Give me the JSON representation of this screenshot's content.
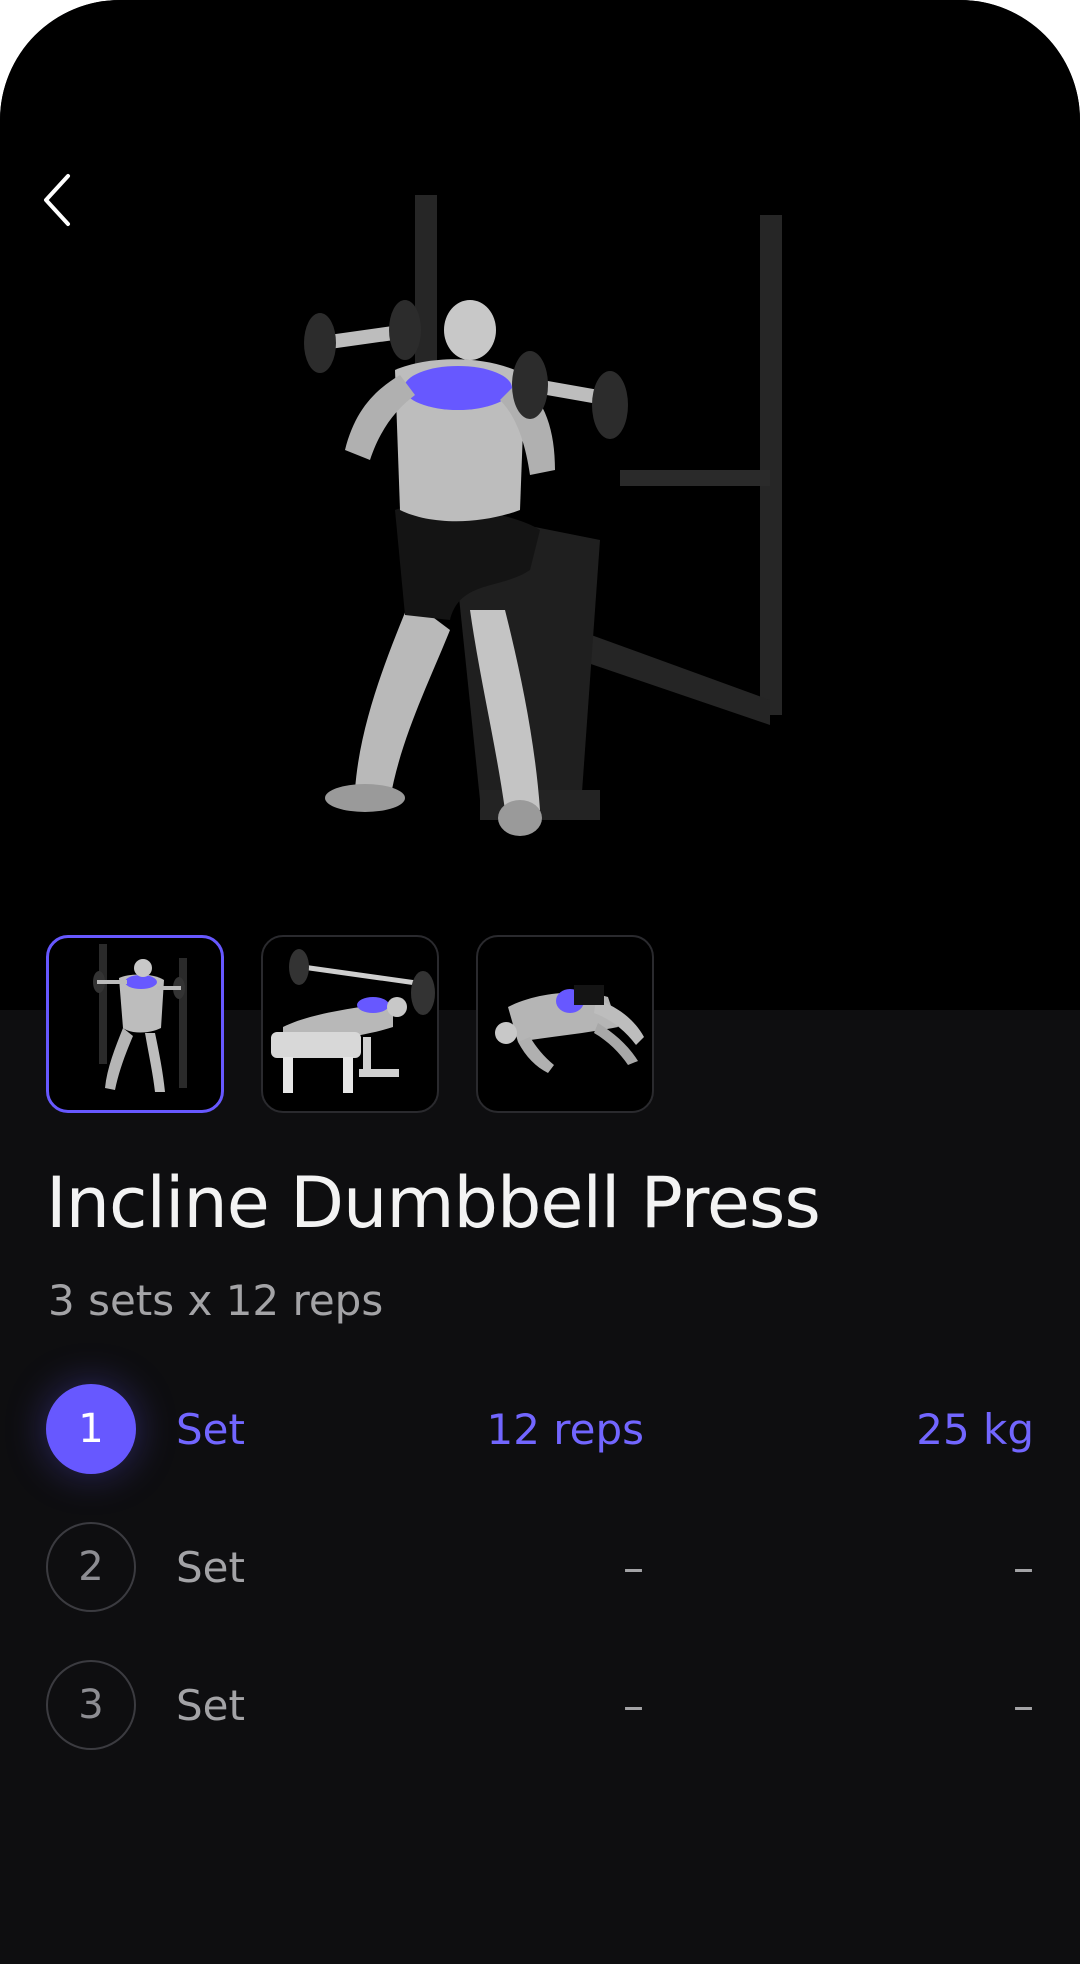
{
  "colors": {
    "accent": "#6758ff",
    "background": "#0e0e10",
    "hero_background": "#000000",
    "text_primary": "#f3f3f3",
    "text_secondary": "#a3a3a6"
  },
  "header": {
    "back_icon": "chevron-left-icon"
  },
  "hero": {
    "image": "incline-dumbbell-press-illustration"
  },
  "thumbnails": [
    {
      "image": "incline-dumbbell-press-thumbnail",
      "selected": true
    },
    {
      "image": "barbell-bench-press-thumbnail",
      "selected": false
    },
    {
      "image": "floor-exercise-thumbnail",
      "selected": false
    }
  ],
  "exercise": {
    "title": "Incline Dumbbell Press",
    "summary": "3 sets x 12 reps"
  },
  "sets": [
    {
      "number": "1",
      "label": "Set",
      "reps": "12 reps",
      "weight": "25 kg",
      "active": true
    },
    {
      "number": "2",
      "label": "Set",
      "reps": "–",
      "weight": "–",
      "active": false
    },
    {
      "number": "3",
      "label": "Set",
      "reps": "–",
      "weight": "–",
      "active": false
    }
  ]
}
